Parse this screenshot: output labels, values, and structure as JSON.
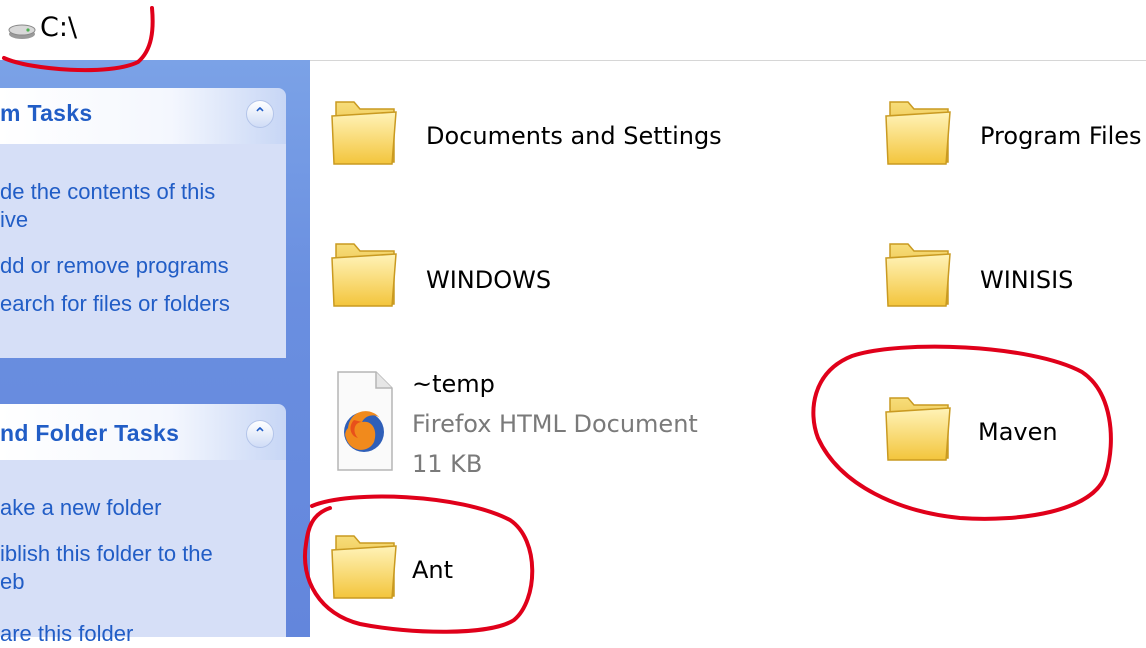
{
  "address_bar": {
    "path": "C:\\",
    "icon": "drive-icon"
  },
  "sidebar": {
    "system_tasks": {
      "title": "m Tasks",
      "items": [
        {
          "label": "de the contents of this\nive"
        },
        {
          "label": "dd or remove programs"
        },
        {
          "label": "earch for files or folders"
        }
      ]
    },
    "file_tasks": {
      "title": "nd Folder Tasks",
      "items": [
        {
          "label": "ake a new folder"
        },
        {
          "label": "iblish this folder to the\neb"
        },
        {
          "label": "are this folder"
        }
      ]
    }
  },
  "files": [
    {
      "name": "Documents and Settings",
      "type": "folder"
    },
    {
      "name": "Program Files",
      "type": "folder"
    },
    {
      "name": "WINDOWS",
      "type": "folder"
    },
    {
      "name": "WINISIS",
      "type": "folder"
    },
    {
      "name": "~temp",
      "type": "file",
      "description": "Firefox HTML Document",
      "size": "11 KB"
    },
    {
      "name": "Maven",
      "type": "folder"
    },
    {
      "name": "Ant",
      "type": "folder"
    }
  ],
  "colors": {
    "sidebar": "#6a8fe0",
    "task_link": "#215dc6",
    "annotation": "#e0001a",
    "folder": "#f7d35a"
  }
}
